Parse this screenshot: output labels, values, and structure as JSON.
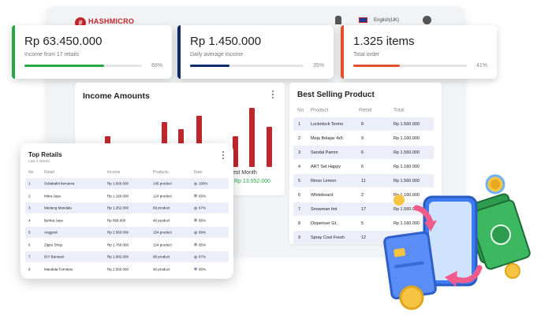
{
  "header": {
    "logo_mark": "#",
    "logo_name": "HASHMICRO",
    "logo_tag": "THINK FORWARD",
    "language": "English(UK)"
  },
  "kpis": [
    {
      "value": "Rp 63.450.000",
      "label": "Income from 17 retails",
      "progress_pct": 68,
      "pct_label": "68%",
      "color": "#27a844"
    },
    {
      "value": "Rp 1.450.000",
      "label": "Daily average income",
      "progress_pct": 35,
      "pct_label": "35%",
      "color": "#0d2b6e"
    },
    {
      "value": "1.325 items",
      "label": "Total order",
      "progress_pct": 41,
      "pct_label": "41%",
      "color": "#e0522c"
    }
  ],
  "income": {
    "title": "Income Amounts",
    "best_month_label": "est Month",
    "best_month_value": "Rp 13.552.000",
    "bar_color": "#c0262d"
  },
  "chart_data": {
    "type": "bar",
    "title": "Income Amounts",
    "values": [
      0.05,
      0.5,
      0.35,
      0.73,
      0.62,
      0.83,
      0.28,
      0.5,
      0.96,
      0.66,
      0.13,
      0.2
    ],
    "note": "relative bar heights (no axis printed)"
  },
  "best_selling": {
    "title": "Best Selling Product",
    "headers": {
      "no": "No",
      "product": "Product",
      "retail": "Retail",
      "total": "Total"
    },
    "rows": [
      {
        "no": "1",
        "product": "Locknlock Termo",
        "retail": "8",
        "total": "Rp 1.560.000"
      },
      {
        "no": "2",
        "product": "Meja Belajar 4x5",
        "retail": "9",
        "total": "Rp 1.160.000"
      },
      {
        "no": "3",
        "product": "Sandal Pamm",
        "retail": "6",
        "total": "Rp 1.560.000"
      },
      {
        "no": "4",
        "product": "ART Set Happy",
        "retail": "6",
        "total": "Rp 1.160.000"
      },
      {
        "no": "5",
        "product": "Rinso Lemon",
        "retail": "11",
        "total": "Rp 1.560.000"
      },
      {
        "no": "6",
        "product": "Whiteboard",
        "retail": "2",
        "total": "Rp 1.160.000"
      },
      {
        "no": "7",
        "product": "Snowman tint",
        "retail": "17",
        "total": "Rp 1.560.000"
      },
      {
        "no": "8",
        "product": "Dispenser GL",
        "retail": "5",
        "total": "Rp 1.160.000"
      },
      {
        "no": "9",
        "product": "Spray Cool Fresh",
        "retail": "12",
        "total": "Rp 1.560.000"
      }
    ]
  },
  "top_retails": {
    "title": "Top Retails",
    "subtitle": "Last 2 Weeks",
    "headers": {
      "no": "No",
      "retail": "Retail",
      "income": "Income",
      "products": "Products",
      "rate": "Rate"
    },
    "rows": [
      {
        "no": "1",
        "retail": "Sukabakti bersama",
        "income": "Rp 1.560.000",
        "products": "145 product",
        "rate": "100%"
      },
      {
        "no": "2",
        "retail": "Mitra Jaya",
        "income": "Rp 1.160.000",
        "products": "124 product",
        "rate": "95%"
      },
      {
        "no": "3",
        "retail": "Medang Mandala",
        "income": "Rp 1.252.000",
        "products": "89 product",
        "rate": "67%"
      },
      {
        "no": "4",
        "retail": "Berkat Jaya",
        "income": "Rp 868.000",
        "products": "46 product",
        "rate": "95%"
      },
      {
        "no": "5",
        "retail": "Anggrek",
        "income": "Rp 2.560.000",
        "products": "154 product",
        "rate": "89%"
      },
      {
        "no": "6",
        "retail": "Zippo Shop",
        "income": "Rp 1.760.000",
        "products": "124 product",
        "rate": "95%"
      },
      {
        "no": "7",
        "retail": "DIY Bantuan",
        "income": "Rp 1.682.000",
        "products": "98 product",
        "rate": "67%"
      },
      {
        "no": "8",
        "retail": "Mandala Furniture",
        "income": "Rp 2.560.000",
        "products": "46 product",
        "rate": "95%"
      }
    ]
  }
}
